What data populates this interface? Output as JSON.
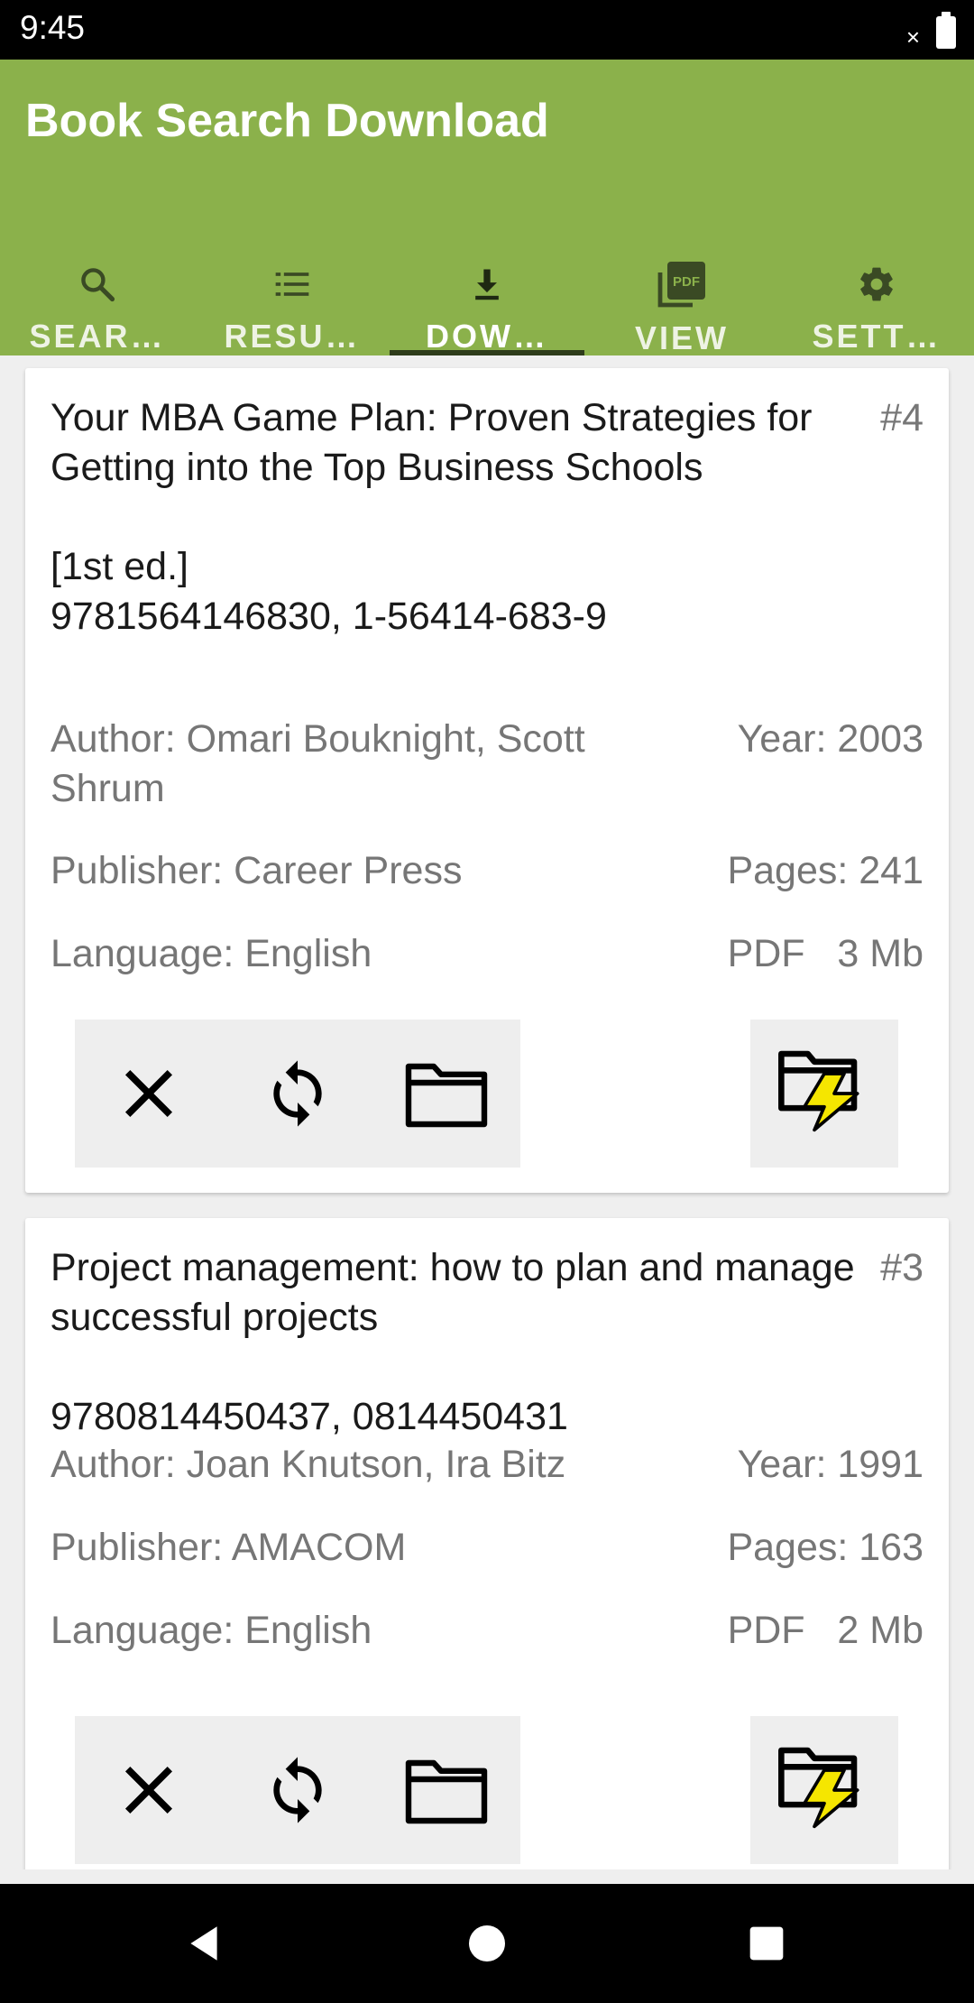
{
  "status_bar": {
    "time": "9:45",
    "signal_glyph": "×"
  },
  "app": {
    "title": "Book Search Download"
  },
  "tabs": [
    {
      "label": "SEAR…",
      "icon": "search-icon"
    },
    {
      "label": "RESU…",
      "icon": "list-icon"
    },
    {
      "label": "DOW…",
      "icon": "download-icon",
      "active": true
    },
    {
      "label": "VIEW",
      "icon": "pdf-icon"
    },
    {
      "label": "SETT…",
      "icon": "gear-icon"
    }
  ],
  "pdf_icon_text": "PDF",
  "books": [
    {
      "title": "Your MBA Game Plan: Proven Strategies for Getting into the Top Business Schools\n\n[1st ed.]\n9781564146830, 1-56414-683-9",
      "number": "#4",
      "author": "Author: Omari Bouknight, Scott Shrum",
      "year": "Year: 2003",
      "publisher": "Publisher: Career Press",
      "pages": "Pages: 241",
      "language": "Language: English",
      "format": "PDF   3 Mb"
    },
    {
      "title": "Project management: how to plan and manage successful projects\n\n9780814450437, 0814450431",
      "number": "#3",
      "author": "Author: Joan Knutson, Ira Bitz",
      "year": "Year: 1991",
      "publisher": "Publisher: AMACOM",
      "pages": "Pages: 163",
      "language": "Language: English",
      "format": "PDF   2 Mb"
    }
  ],
  "colors": {
    "app_bar": "#8bb14b",
    "tab_indicator": "#2e3c1a",
    "lightning": "#f5e600"
  }
}
